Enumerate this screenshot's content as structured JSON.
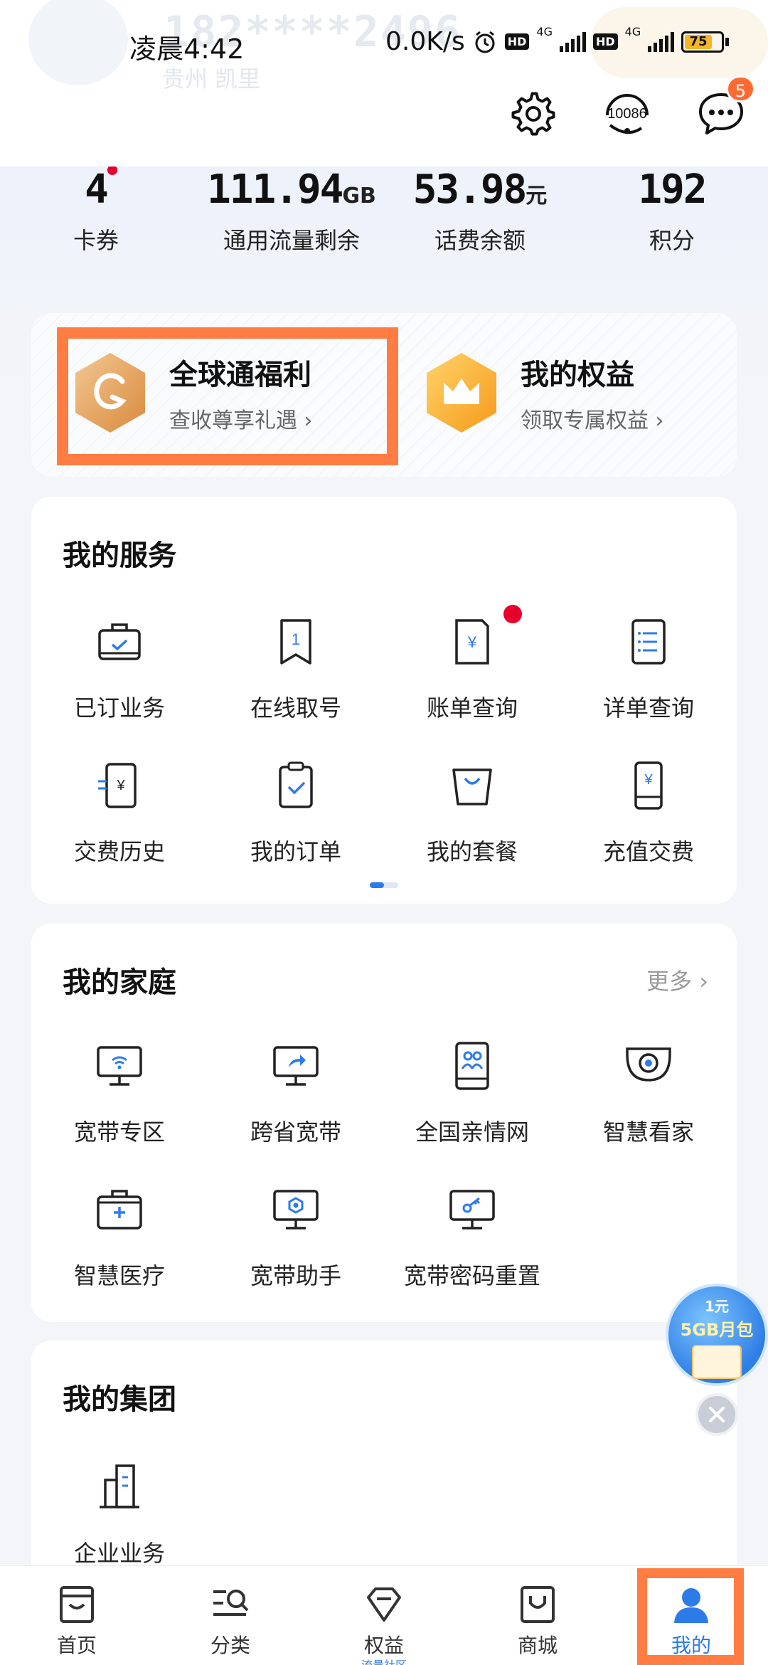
{
  "status_bar": {
    "time": "凌晨4:42",
    "speed": "0.0K/s",
    "net1": "4G",
    "net2": "4G",
    "battery": "75"
  },
  "profile_ghost": {
    "phone": "182****2496",
    "city": "贵州  凯里"
  },
  "header": {
    "service_number": "10086",
    "message_badge": "5"
  },
  "stats": [
    {
      "value": "4",
      "unit": "",
      "label": "卡券"
    },
    {
      "value": "111.94",
      "unit": "GB",
      "label": "通用流量剩余"
    },
    {
      "value": "53.98",
      "unit": "元",
      "label": "话费余额"
    },
    {
      "value": "192",
      "unit": "",
      "label": "积分"
    }
  ],
  "benefits": [
    {
      "title": "全球通福利",
      "subtitle": "查收尊享礼遇 ›"
    },
    {
      "title": "我的权益",
      "subtitle": "领取专属权益 ›"
    }
  ],
  "services": {
    "title": "我的服务",
    "items": [
      {
        "label": "已订业务",
        "icon": "briefcase-check-icon"
      },
      {
        "label": "在线取号",
        "icon": "ticket-number-icon"
      },
      {
        "label": "账单查询",
        "icon": "bill-yen-icon"
      },
      {
        "label": "详单查询",
        "icon": "list-document-icon"
      },
      {
        "label": "交费历史",
        "icon": "payment-history-icon"
      },
      {
        "label": "我的订单",
        "icon": "clipboard-check-icon"
      },
      {
        "label": "我的套餐",
        "icon": "shopping-bag-icon"
      },
      {
        "label": "充值交费",
        "icon": "phone-yen-icon"
      }
    ]
  },
  "family": {
    "title": "我的家庭",
    "more": "更多 ›",
    "items": [
      {
        "label": "宽带专区",
        "icon": "wifi-monitor-icon"
      },
      {
        "label": "跨省宽带",
        "icon": "share-monitor-icon"
      },
      {
        "label": "全国亲情网",
        "icon": "family-phone-icon"
      },
      {
        "label": "智慧看家",
        "icon": "camera-icon"
      },
      {
        "label": "智慧医疗",
        "icon": "medical-kit-icon"
      },
      {
        "label": "宽带助手",
        "icon": "gear-monitor-icon"
      },
      {
        "label": "宽带密码重置",
        "icon": "key-monitor-icon"
      }
    ]
  },
  "group": {
    "title": "我的集团",
    "items": [
      {
        "label": "企业业务",
        "icon": "building-icon"
      }
    ]
  },
  "promo": {
    "line1": "1元",
    "line2": "5GB月包"
  },
  "tabbar": [
    {
      "label": "首页",
      "sub": ""
    },
    {
      "label": "分类",
      "sub": ""
    },
    {
      "label": "权益",
      "sub": "流量社区"
    },
    {
      "label": "商城",
      "sub": ""
    },
    {
      "label": "我的",
      "sub": ""
    }
  ],
  "colors": {
    "accent": "#2d7be9",
    "highlight": "#ff7d42",
    "red_dot": "#e7002b"
  }
}
